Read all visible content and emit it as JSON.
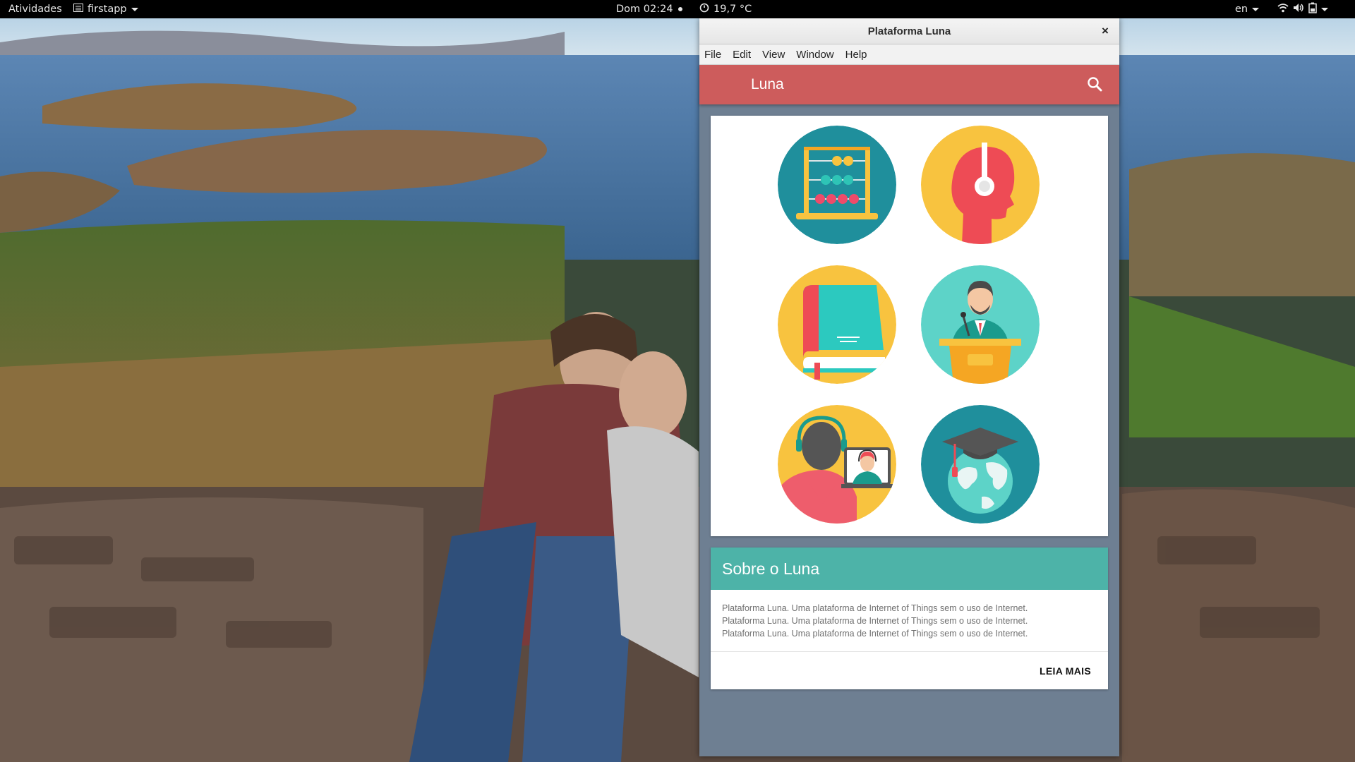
{
  "topbar": {
    "activities": "Atividades",
    "app_name": "firstapp",
    "clock": "Dom 02:24",
    "weather": "19,7 °C",
    "language": "en",
    "status_icons": [
      "wifi-icon",
      "volume-icon",
      "battery-icon"
    ]
  },
  "window": {
    "title": "Plataforma Luna",
    "close_label": "×",
    "menu": [
      "File",
      "Edit",
      "View",
      "Window",
      "Help"
    ]
  },
  "appbar": {
    "title": "Luna",
    "color": "#cd5c5c"
  },
  "grid": {
    "items": [
      {
        "icon": "abacus-icon",
        "bg": "#1f8f9c"
      },
      {
        "icon": "headphones-head-icon",
        "bg": "#f8c33f"
      },
      {
        "icon": "book-icon",
        "bg": "#f8c33f"
      },
      {
        "icon": "speaker-podium-icon",
        "bg": "#5dd3c8"
      },
      {
        "icon": "video-conference-icon",
        "bg": "#f8c33f"
      },
      {
        "icon": "graduation-globe-icon",
        "bg": "#1f8f9c"
      }
    ]
  },
  "about": {
    "title": "Sobre o Luna",
    "lines": [
      "Plataforma Luna. Uma plataforma de Internet of Things sem o uso de Internet.",
      "Plataforma Luna. Uma plataforma de Internet of Things sem o uso de Internet.",
      "Plataforma Luna. Uma plataforma de Internet of Things sem o uso de Internet."
    ],
    "action": "LEIA MAIS",
    "header_color": "#4db3a8"
  }
}
